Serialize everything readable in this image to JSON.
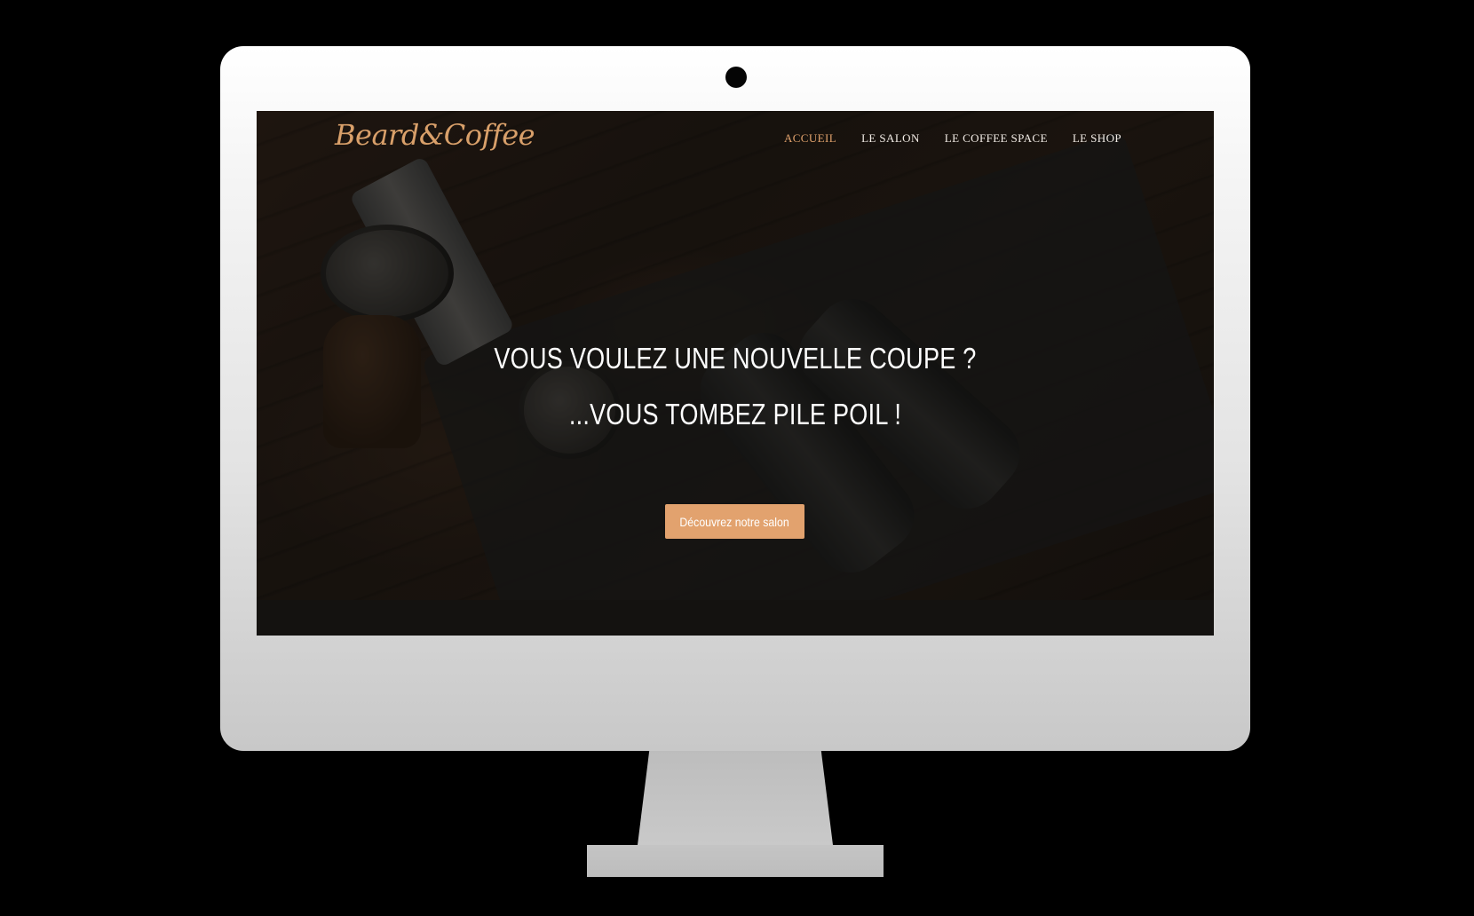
{
  "site": {
    "logo": "Beard&Coffee"
  },
  "nav": {
    "items": [
      {
        "label": "ACCUEIL",
        "active": true
      },
      {
        "label": "LE SALON",
        "active": false
      },
      {
        "label": "LE COFFEE SPACE",
        "active": false
      },
      {
        "label": "LE SHOP",
        "active": false
      }
    ]
  },
  "hero": {
    "line1": "VOUS VOULEZ UNE NOUVELLE COUPE ?",
    "line2": "...VOUS TOMBEZ PILE POIL !",
    "cta_label": "Découvrez notre salon"
  },
  "colors": {
    "accent": "#e2a26e",
    "background": "#000000",
    "monitor": "#e3e3e3"
  }
}
